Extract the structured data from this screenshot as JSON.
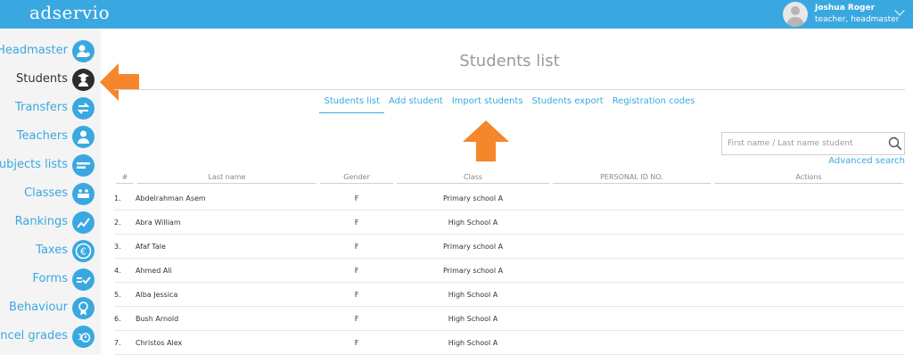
{
  "header": {
    "logo": "adservio",
    "user_name": "Joshua Roger",
    "user_role": "teacher, headmaster",
    "accent": "#3aa8e0"
  },
  "sidebar": {
    "items": [
      {
        "label": "Headmaster",
        "icon": "headmaster-icon",
        "active": false
      },
      {
        "label": "Students",
        "icon": "student-icon",
        "active": true
      },
      {
        "label": "Transfers",
        "icon": "transfer-arrows-icon",
        "active": false
      },
      {
        "label": "Teachers",
        "icon": "teacher-icon",
        "active": false
      },
      {
        "label": "Subjects lists",
        "icon": "list-icon",
        "active": false
      },
      {
        "label": "Classes",
        "icon": "classroom-icon",
        "active": false
      },
      {
        "label": "Rankings",
        "icon": "trend-icon",
        "active": false
      },
      {
        "label": "Taxes",
        "icon": "euro-icon",
        "active": false
      },
      {
        "label": "Forms",
        "icon": "form-check-icon",
        "active": false
      },
      {
        "label": "Behaviour",
        "icon": "medal-icon",
        "active": false
      },
      {
        "label": "Cancel grades",
        "icon": "cancel-grade-icon",
        "active": false
      }
    ]
  },
  "main": {
    "title": "Students list",
    "tabs": [
      {
        "label": "Students list",
        "active": true
      },
      {
        "label": "Add student",
        "active": false
      },
      {
        "label": "Import students",
        "active": false
      },
      {
        "label": "Students export",
        "active": false
      },
      {
        "label": "Registration codes",
        "active": false
      }
    ],
    "search": {
      "placeholder": "First name / Last name student"
    },
    "advanced_search": "Advanced search"
  },
  "table": {
    "headers": [
      "#",
      "Last name",
      "Gender",
      "Class",
      "PERSONAL ID NO.",
      "Actions"
    ],
    "rows": [
      {
        "num": "1.",
        "name": "Abdelrahman Asem",
        "gender": "F",
        "class": "Primary school A"
      },
      {
        "num": "2.",
        "name": "Abra William",
        "gender": "F",
        "class": "High School A"
      },
      {
        "num": "3.",
        "name": "Afaf Tale",
        "gender": "F",
        "class": "Primary school A"
      },
      {
        "num": "4.",
        "name": "Ahmed Ali",
        "gender": "F",
        "class": "Primary school A"
      },
      {
        "num": "5.",
        "name": "Alba Jessica",
        "gender": "F",
        "class": "High School A"
      },
      {
        "num": "6.",
        "name": "Bush Arnold",
        "gender": "F",
        "class": "High School A"
      },
      {
        "num": "7.",
        "name": "Christos Alex",
        "gender": "F",
        "class": "High School A"
      }
    ]
  },
  "annotations": {
    "arrow_color": "#f5862b"
  }
}
